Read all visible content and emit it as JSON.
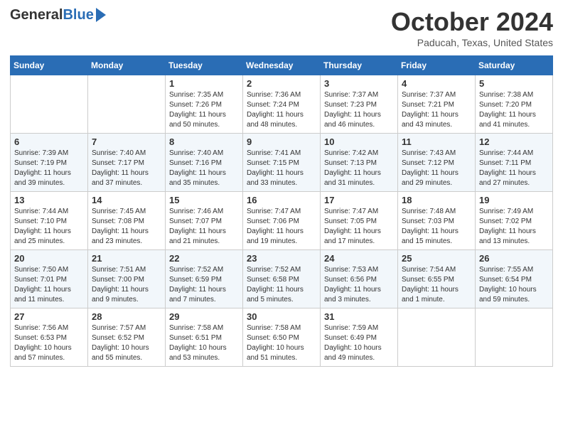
{
  "header": {
    "logo_general": "General",
    "logo_blue": "Blue",
    "month_title": "October 2024",
    "location": "Paducah, Texas, United States"
  },
  "days_of_week": [
    "Sunday",
    "Monday",
    "Tuesday",
    "Wednesday",
    "Thursday",
    "Friday",
    "Saturday"
  ],
  "weeks": [
    [
      {
        "day": "",
        "sunrise": "",
        "sunset": "",
        "daylight": ""
      },
      {
        "day": "",
        "sunrise": "",
        "sunset": "",
        "daylight": ""
      },
      {
        "day": "1",
        "sunrise": "Sunrise: 7:35 AM",
        "sunset": "Sunset: 7:26 PM",
        "daylight": "Daylight: 11 hours and 50 minutes."
      },
      {
        "day": "2",
        "sunrise": "Sunrise: 7:36 AM",
        "sunset": "Sunset: 7:24 PM",
        "daylight": "Daylight: 11 hours and 48 minutes."
      },
      {
        "day": "3",
        "sunrise": "Sunrise: 7:37 AM",
        "sunset": "Sunset: 7:23 PM",
        "daylight": "Daylight: 11 hours and 46 minutes."
      },
      {
        "day": "4",
        "sunrise": "Sunrise: 7:37 AM",
        "sunset": "Sunset: 7:21 PM",
        "daylight": "Daylight: 11 hours and 43 minutes."
      },
      {
        "day": "5",
        "sunrise": "Sunrise: 7:38 AM",
        "sunset": "Sunset: 7:20 PM",
        "daylight": "Daylight: 11 hours and 41 minutes."
      }
    ],
    [
      {
        "day": "6",
        "sunrise": "Sunrise: 7:39 AM",
        "sunset": "Sunset: 7:19 PM",
        "daylight": "Daylight: 11 hours and 39 minutes."
      },
      {
        "day": "7",
        "sunrise": "Sunrise: 7:40 AM",
        "sunset": "Sunset: 7:17 PM",
        "daylight": "Daylight: 11 hours and 37 minutes."
      },
      {
        "day": "8",
        "sunrise": "Sunrise: 7:40 AM",
        "sunset": "Sunset: 7:16 PM",
        "daylight": "Daylight: 11 hours and 35 minutes."
      },
      {
        "day": "9",
        "sunrise": "Sunrise: 7:41 AM",
        "sunset": "Sunset: 7:15 PM",
        "daylight": "Daylight: 11 hours and 33 minutes."
      },
      {
        "day": "10",
        "sunrise": "Sunrise: 7:42 AM",
        "sunset": "Sunset: 7:13 PM",
        "daylight": "Daylight: 11 hours and 31 minutes."
      },
      {
        "day": "11",
        "sunrise": "Sunrise: 7:43 AM",
        "sunset": "Sunset: 7:12 PM",
        "daylight": "Daylight: 11 hours and 29 minutes."
      },
      {
        "day": "12",
        "sunrise": "Sunrise: 7:44 AM",
        "sunset": "Sunset: 7:11 PM",
        "daylight": "Daylight: 11 hours and 27 minutes."
      }
    ],
    [
      {
        "day": "13",
        "sunrise": "Sunrise: 7:44 AM",
        "sunset": "Sunset: 7:10 PM",
        "daylight": "Daylight: 11 hours and 25 minutes."
      },
      {
        "day": "14",
        "sunrise": "Sunrise: 7:45 AM",
        "sunset": "Sunset: 7:08 PM",
        "daylight": "Daylight: 11 hours and 23 minutes."
      },
      {
        "day": "15",
        "sunrise": "Sunrise: 7:46 AM",
        "sunset": "Sunset: 7:07 PM",
        "daylight": "Daylight: 11 hours and 21 minutes."
      },
      {
        "day": "16",
        "sunrise": "Sunrise: 7:47 AM",
        "sunset": "Sunset: 7:06 PM",
        "daylight": "Daylight: 11 hours and 19 minutes."
      },
      {
        "day": "17",
        "sunrise": "Sunrise: 7:47 AM",
        "sunset": "Sunset: 7:05 PM",
        "daylight": "Daylight: 11 hours and 17 minutes."
      },
      {
        "day": "18",
        "sunrise": "Sunrise: 7:48 AM",
        "sunset": "Sunset: 7:03 PM",
        "daylight": "Daylight: 11 hours and 15 minutes."
      },
      {
        "day": "19",
        "sunrise": "Sunrise: 7:49 AM",
        "sunset": "Sunset: 7:02 PM",
        "daylight": "Daylight: 11 hours and 13 minutes."
      }
    ],
    [
      {
        "day": "20",
        "sunrise": "Sunrise: 7:50 AM",
        "sunset": "Sunset: 7:01 PM",
        "daylight": "Daylight: 11 hours and 11 minutes."
      },
      {
        "day": "21",
        "sunrise": "Sunrise: 7:51 AM",
        "sunset": "Sunset: 7:00 PM",
        "daylight": "Daylight: 11 hours and 9 minutes."
      },
      {
        "day": "22",
        "sunrise": "Sunrise: 7:52 AM",
        "sunset": "Sunset: 6:59 PM",
        "daylight": "Daylight: 11 hours and 7 minutes."
      },
      {
        "day": "23",
        "sunrise": "Sunrise: 7:52 AM",
        "sunset": "Sunset: 6:58 PM",
        "daylight": "Daylight: 11 hours and 5 minutes."
      },
      {
        "day": "24",
        "sunrise": "Sunrise: 7:53 AM",
        "sunset": "Sunset: 6:56 PM",
        "daylight": "Daylight: 11 hours and 3 minutes."
      },
      {
        "day": "25",
        "sunrise": "Sunrise: 7:54 AM",
        "sunset": "Sunset: 6:55 PM",
        "daylight": "Daylight: 11 hours and 1 minute."
      },
      {
        "day": "26",
        "sunrise": "Sunrise: 7:55 AM",
        "sunset": "Sunset: 6:54 PM",
        "daylight": "Daylight: 10 hours and 59 minutes."
      }
    ],
    [
      {
        "day": "27",
        "sunrise": "Sunrise: 7:56 AM",
        "sunset": "Sunset: 6:53 PM",
        "daylight": "Daylight: 10 hours and 57 minutes."
      },
      {
        "day": "28",
        "sunrise": "Sunrise: 7:57 AM",
        "sunset": "Sunset: 6:52 PM",
        "daylight": "Daylight: 10 hours and 55 minutes."
      },
      {
        "day": "29",
        "sunrise": "Sunrise: 7:58 AM",
        "sunset": "Sunset: 6:51 PM",
        "daylight": "Daylight: 10 hours and 53 minutes."
      },
      {
        "day": "30",
        "sunrise": "Sunrise: 7:58 AM",
        "sunset": "Sunset: 6:50 PM",
        "daylight": "Daylight: 10 hours and 51 minutes."
      },
      {
        "day": "31",
        "sunrise": "Sunrise: 7:59 AM",
        "sunset": "Sunset: 6:49 PM",
        "daylight": "Daylight: 10 hours and 49 minutes."
      },
      {
        "day": "",
        "sunrise": "",
        "sunset": "",
        "daylight": ""
      },
      {
        "day": "",
        "sunrise": "",
        "sunset": "",
        "daylight": ""
      }
    ]
  ]
}
